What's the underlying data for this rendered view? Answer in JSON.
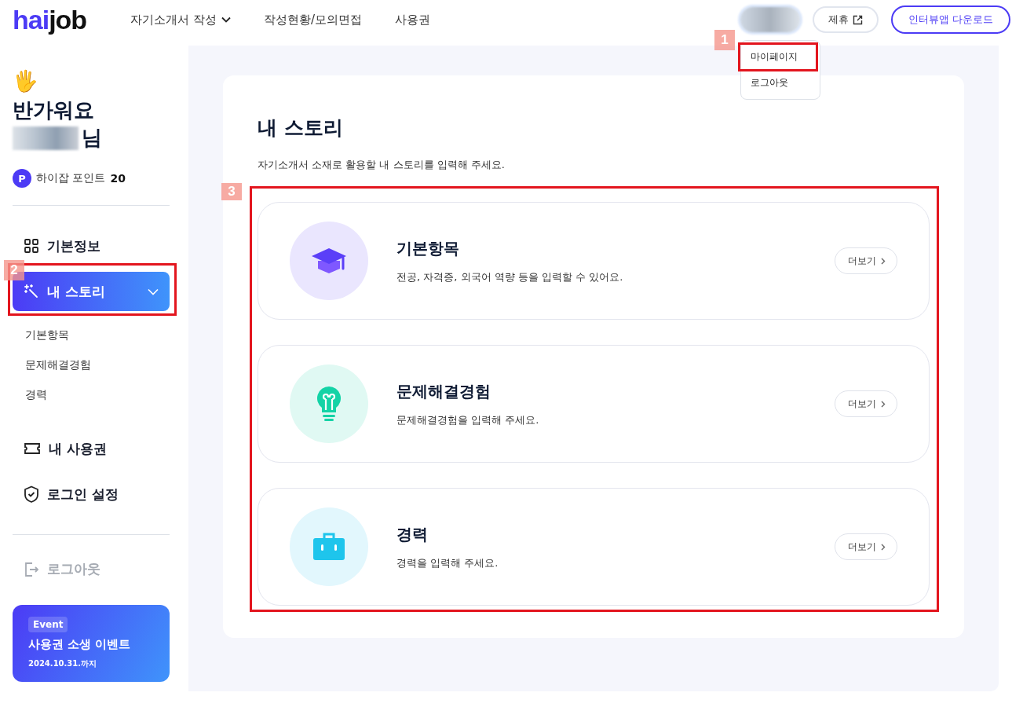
{
  "header": {
    "logo_accent": "hai",
    "logo_rest": "job",
    "nav": [
      {
        "label": "자기소개서 작성",
        "has_menu": true
      },
      {
        "label": "작성현황/모의면접",
        "has_menu": false
      },
      {
        "label": "사용권",
        "has_menu": false
      }
    ],
    "partner_button": "제휴",
    "download_button": "인터뷰앱 다운로드",
    "profile_menu": [
      {
        "label": "마이페이지",
        "callout": "1"
      },
      {
        "label": "로그아웃"
      }
    ]
  },
  "sidebar": {
    "emoji": "🖐",
    "greeting": "반가워요",
    "name_suffix": "님",
    "points_badge": "P",
    "points_label": "하이잡 포인트",
    "points_value": "20",
    "items": [
      {
        "label": "기본정보",
        "selected": false
      },
      {
        "label": "내 스토리",
        "selected": true,
        "expanded": true,
        "callout": "2",
        "children": [
          {
            "label": "기본항목"
          },
          {
            "label": "문제해결경험"
          },
          {
            "label": "경력"
          }
        ]
      },
      {
        "label": "내 사용권",
        "selected": false
      },
      {
        "label": "로그인 설정",
        "selected": false
      }
    ],
    "logout": "로그아웃",
    "event": {
      "tag": "Event",
      "title": "사용권 소생 이벤트",
      "date": "2024.10.31.까지"
    }
  },
  "main": {
    "title": "내 스토리",
    "subtitle": "자기소개서 소재로 활용할 내 스토리를 입력해 주세요.",
    "callout": "3",
    "cards": [
      {
        "title": "기본항목",
        "description": "전공, 자격증, 외국어 역량 등을 입력할 수 있어요.",
        "color": "#5b3ff8",
        "button": "더보기"
      },
      {
        "title": "문제해결경험",
        "description": "문제해결경험을 입력해 주세요.",
        "color": "#14d3a6",
        "button": "더보기"
      },
      {
        "title": "경력",
        "description": "경력을 입력해 주세요.",
        "color": "#1ec5ec",
        "button": "더보기"
      }
    ]
  }
}
